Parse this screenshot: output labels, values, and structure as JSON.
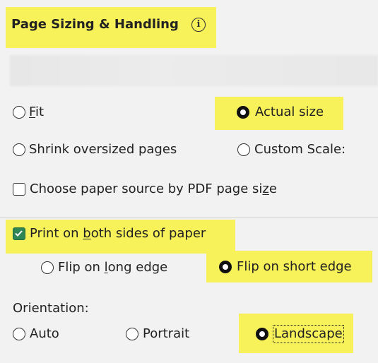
{
  "section": {
    "title": "Page Sizing & Handling",
    "info_icon": "info-icon"
  },
  "sizing": {
    "options": [
      {
        "label_prefix": "",
        "label_u": "F",
        "label_rest": "it",
        "checked": false
      },
      {
        "label": "Actual size",
        "checked": true
      },
      {
        "label": "Shrink oversized pages",
        "checked": false
      },
      {
        "label": "Custom Scale:",
        "checked": false
      }
    ],
    "paper_source": {
      "label_pre": "Choose paper source by PDF page si",
      "label_u": "z",
      "label_post": "e",
      "checked": false
    }
  },
  "duplex": {
    "print_both": {
      "label_pre": "Print on ",
      "label_u": "b",
      "label_post": "oth sides of paper",
      "checked": true
    },
    "flip_long": {
      "label_pre": "Flip on ",
      "label_u": "l",
      "label_post": "ong edge",
      "checked": false
    },
    "flip_short": {
      "label": "Flip on short edge",
      "checked": true
    }
  },
  "orientation": {
    "label": "Orientation:",
    "options": [
      {
        "label": "Auto",
        "checked": false
      },
      {
        "label": "Portrait",
        "checked": false
      },
      {
        "label": "Landscape",
        "checked": true
      }
    ]
  },
  "colors": {
    "highlight": "#f7f25a",
    "checkbox_checked": "#2d8653"
  }
}
